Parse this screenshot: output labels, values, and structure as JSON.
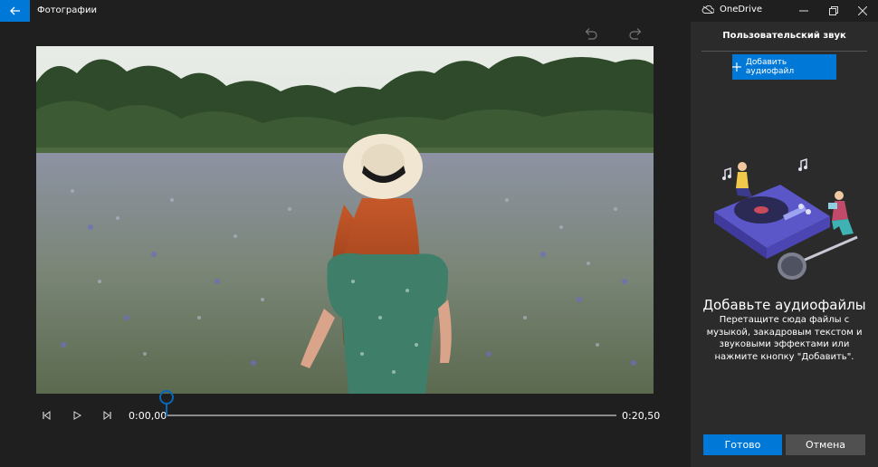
{
  "app": {
    "title": "Фотографии"
  },
  "titlebar": {
    "account": "OneDrive",
    "minimize_icon": "minimize-icon",
    "maximize_icon": "restore-icon",
    "close_icon": "close-icon"
  },
  "toolbar": {
    "undo_icon": "undo-icon",
    "redo_icon": "redo-icon"
  },
  "player": {
    "current_time": "0:00,00",
    "total_time": "0:20,50",
    "progress": 0.0
  },
  "panel": {
    "title": "Пользовательский звук",
    "add_button": "Добавить аудиофайл",
    "heading": "Добавьте аудиофайлы",
    "description": "Перетащите сюда файлы с музыкой, закадровым текстом и звуковыми эффектами или нажмите кнопку \"Добавить\".",
    "done_button": "Готово",
    "cancel_button": "Отмена"
  },
  "colors": {
    "accent": "#0078d7",
    "background": "#1f1f1f",
    "panel": "#2b2b2b",
    "secondary_button": "#505050"
  }
}
